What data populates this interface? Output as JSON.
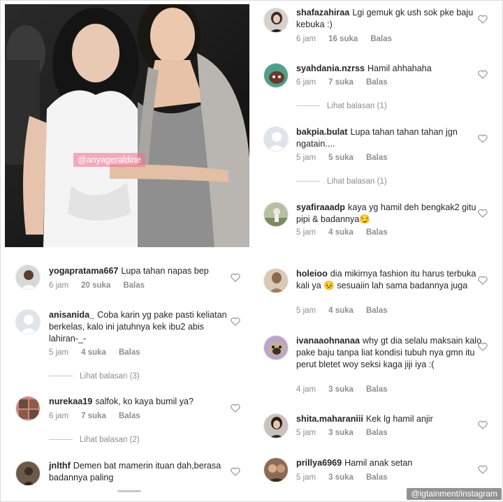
{
  "photo": {
    "tag_text": "@anyageraldine"
  },
  "left_comments": [
    {
      "username": "yogapratama667",
      "text": "Lupa tahan napas bep",
      "time": "6 jam",
      "likes": "20 suka",
      "reply": "Balas",
      "avatar": "user-avatar-photo"
    },
    {
      "username": "anisanida_",
      "text": "Coba karin yg pake pasti keliatan berkelas, kalo ini jatuhnya kek ibu2 abis lahiran-_-",
      "time": "5 jam",
      "likes": "4 suka",
      "reply": "Balas",
      "avatar": "default-avatar",
      "view_replies": "Lihat balasan (3)"
    },
    {
      "username": "nurekaa19",
      "text": "salfok, ko kaya bumil ya?",
      "time": "6 jam",
      "likes": "7 suka",
      "reply": "Balas",
      "avatar": "user-avatar-photo",
      "view_replies": "Lihat balasan (2)"
    },
    {
      "username": "jnlthf",
      "text": "Demen bat mamerin ituan dah,berasa badannya paling",
      "time": "",
      "likes": "",
      "reply": "",
      "avatar": "user-avatar-photo"
    }
  ],
  "right_comments": [
    {
      "username": "shafazahiraa",
      "text": "Lgi gemuk gk ush sok pke baju kebuka :)",
      "time": "6 jam",
      "likes": "16 suka",
      "reply": "Balas",
      "avatar": "user-avatar-photo"
    },
    {
      "username": "syahdania.nzrss",
      "text": "Hamil ahhahaha",
      "time": "6 jam",
      "likes": "7 suka",
      "reply": "Balas",
      "avatar": "user-avatar-photo",
      "view_replies": "Lihat balasan (1)"
    },
    {
      "username": "bakpia.bulat",
      "text": "Lupa tahan tahan tahan jgn ngatain....",
      "time": "5 jam",
      "likes": "5 suka",
      "reply": "Balas",
      "avatar": "default-avatar",
      "view_replies": "Lihat balasan (1)"
    },
    {
      "username": "syafiraaadp",
      "text": "kaya yg hamil deh bengkak2 gitu pipi & badannya😏",
      "time": "5 jam",
      "likes": "4 suka",
      "reply": "Balas",
      "avatar": "user-avatar-photo"
    },
    {
      "username": "holeioo",
      "text": "dia mikirnya fashion itu harus terbuka kali ya 😣 sesuaiin lah sama badannya juga",
      "time": "5 jam",
      "likes": "4 suka",
      "reply": "Balas",
      "avatar": "user-avatar-photo"
    },
    {
      "username": "ivanaaohnanaa",
      "text": "why gt dia selalu maksain kalo pake baju tanpa liat kondisi tubuh nya gmn itu perut bletet woy seksi kaga jiji iya :(",
      "time": "4 jam",
      "likes": "3 suka",
      "reply": "Balas",
      "avatar": "user-avatar-photo"
    },
    {
      "username": "shita.maharaniii",
      "text": "Kek lg hamil anjir",
      "time": "5 jam",
      "likes": "3 suka",
      "reply": "Balas",
      "avatar": "user-avatar-photo"
    },
    {
      "username": "prillya6969",
      "text": "Hamil anak setan",
      "time": "5 jam",
      "likes": "3 suka",
      "reply": "Balas",
      "avatar": "user-avatar-photo"
    }
  ],
  "credit": "@igtainment/instagram",
  "colors": {
    "username": "#262626",
    "meta": "#8e8e8e",
    "tag_bg": "#f06e8c"
  }
}
